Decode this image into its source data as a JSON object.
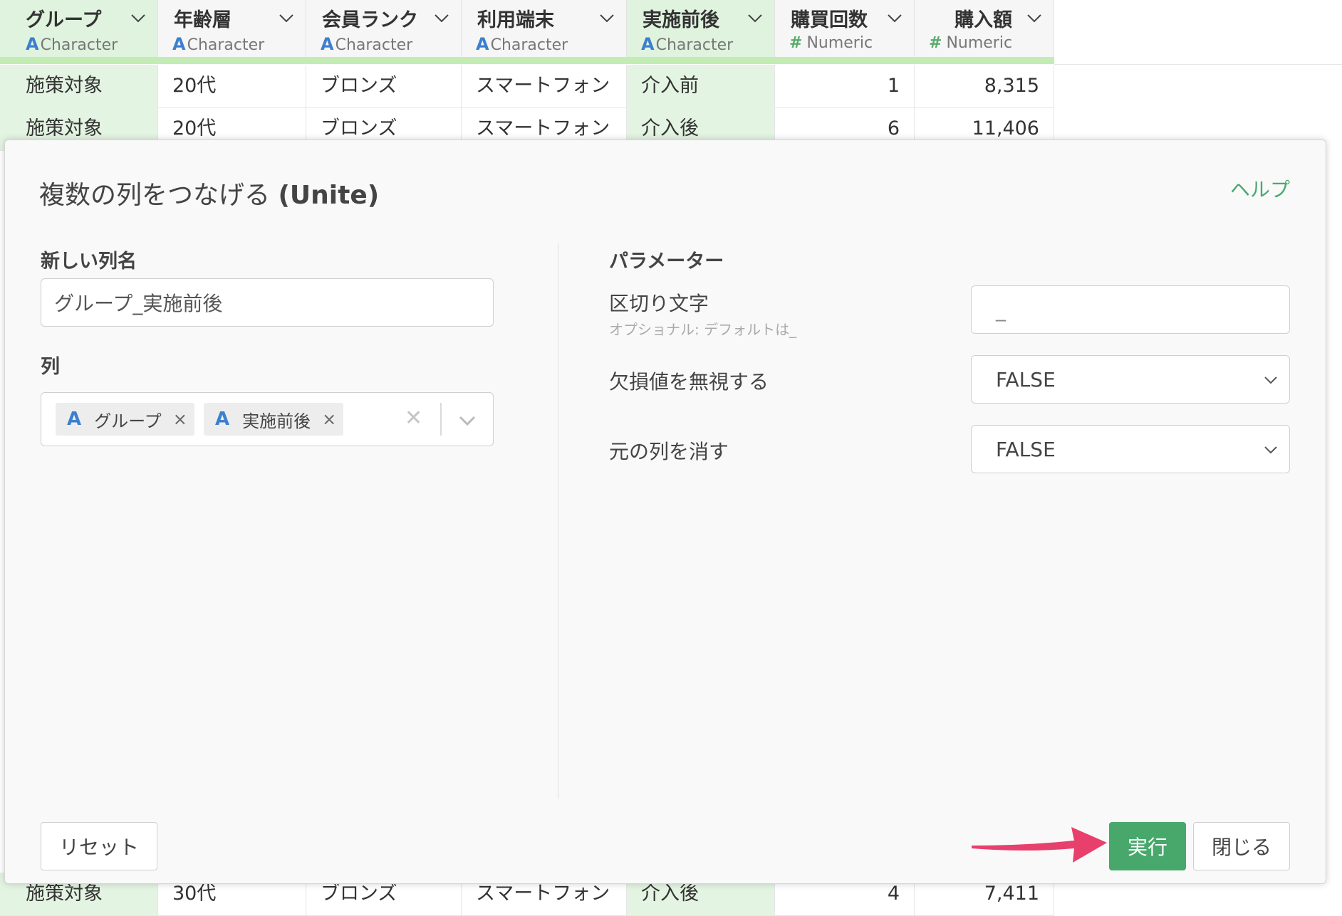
{
  "grid": {
    "columns": [
      {
        "name": "グループ",
        "type": "Character",
        "type_icon": "A",
        "selected": true
      },
      {
        "name": "年齢層",
        "type": "Character",
        "type_icon": "A",
        "selected": false
      },
      {
        "name": "会員ランク",
        "type": "Character",
        "type_icon": "A",
        "selected": false
      },
      {
        "name": "利用端末",
        "type": "Character",
        "type_icon": "A",
        "selected": false
      },
      {
        "name": "実施前後",
        "type": "Character",
        "type_icon": "A",
        "selected": true
      },
      {
        "name": "購買回数",
        "type": "Numeric",
        "type_icon": "#",
        "selected": false
      },
      {
        "name": "購入額",
        "type": "Numeric",
        "type_icon": "#",
        "selected": false
      }
    ],
    "rows": [
      [
        "施策対象",
        "20代",
        "ブロンズ",
        "スマートフォン",
        "介入前",
        "1",
        "8,315"
      ],
      [
        "施策対象",
        "20代",
        "ブロンズ",
        "スマートフォン",
        "介入後",
        "6",
        "11,406"
      ],
      [
        "施策対象",
        "30代",
        "ブロンズ",
        "スマートフォン",
        "介入後",
        "4",
        "7,411"
      ]
    ]
  },
  "dialog": {
    "title": "複数の列をつなげる",
    "title_suffix": "(Unite)",
    "help_label": "ヘルプ",
    "new_column_label": "新しい列名",
    "new_column_value": "グループ_実施前後",
    "columns_label": "列",
    "selected_columns": [
      {
        "type_icon": "A",
        "name": "グループ",
        "remove": "×"
      },
      {
        "type_icon": "A",
        "name": "実施前後",
        "remove": "×"
      }
    ],
    "clear_icon": "✕",
    "params_heading": "パラメーター",
    "separator_label": "区切り文字",
    "separator_hint": "オプショナル: デフォルトは_",
    "separator_value": "_",
    "ignore_na_label": "欠損値を無視する",
    "ignore_na_value": "FALSE",
    "remove_original_label": "元の列を消す",
    "remove_original_value": "FALSE",
    "reset_label": "リセット",
    "run_label": "実行",
    "close_label": "閉じる"
  },
  "colors": {
    "accent_green": "#48a86c",
    "selected_column_bg": "#dff3df",
    "arrow": "#e8406c",
    "type_character": "#3d7fcf",
    "type_numeric": "#5aaa6a"
  }
}
